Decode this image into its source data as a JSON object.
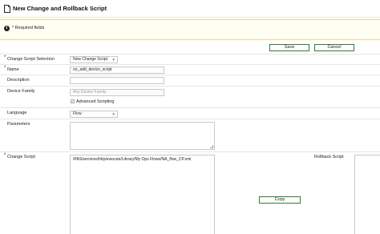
{
  "page": {
    "title": "New Change and Rollback Script",
    "title_icon": "document-icon"
  },
  "notice": {
    "icon": "info-icon",
    "icon_glyph": "i",
    "text": "* Required fields"
  },
  "toolbar": {
    "save_label": "Save",
    "cancel_label": "Cancel",
    "button_border_color": "#2e7d32"
  },
  "form": {
    "change_script_selection": {
      "label": "Change Script Selection",
      "required_marker": "*",
      "value": "New Change Script"
    },
    "name": {
      "label": "Name",
      "required_marker": "*",
      "value": "oo_add_device_script"
    },
    "description": {
      "label": "Description",
      "value": ""
    },
    "device_family": {
      "label": "Device Family",
      "placeholder": "Any Device Family"
    },
    "advanced_scripting": {
      "label": "Advanced Scripting",
      "checked": true,
      "check_glyph": "✓"
    },
    "language": {
      "label": "Language",
      "value": "Flow"
    },
    "parameters": {
      "label": "Parameters",
      "value": ""
    },
    "change_script": {
      "label": "Change Script",
      "required_marker": "*",
      "value": "/PAS/services/http/execute/Library/My Ops Flows/NA_flow_CP.xml"
    },
    "rollback_script": {
      "label": "Rollback Script"
    },
    "copy_label": "Copy"
  }
}
